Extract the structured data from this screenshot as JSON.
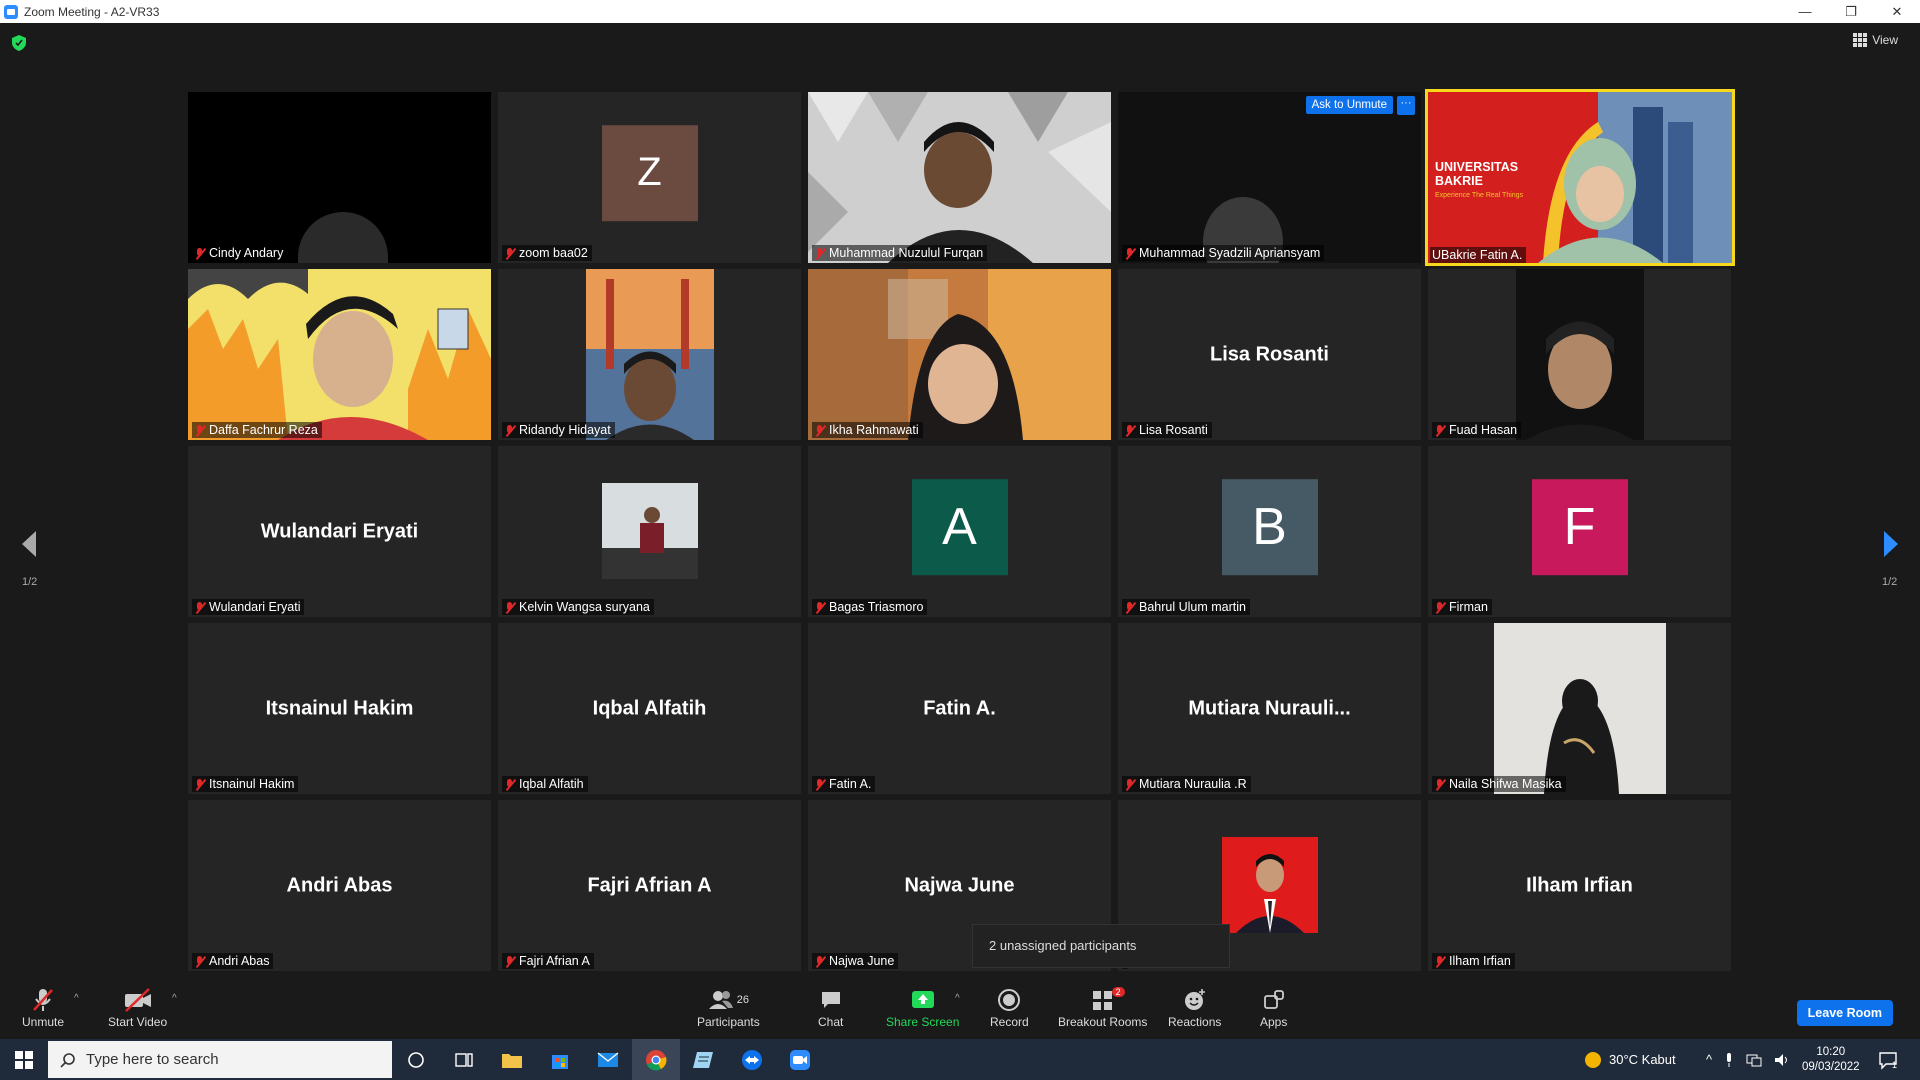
{
  "window": {
    "title": "Zoom Meeting - A2-VR33"
  },
  "header": {
    "view_label": "View"
  },
  "tiles": [
    {
      "name": "Cindy Andary",
      "display": ""
    },
    {
      "name": "zoom baa02",
      "avatar_letter": "Z",
      "avatar_color": "#6b4a3f"
    },
    {
      "name": "Muhammad Nuzulul Furqan"
    },
    {
      "name": "Muhammad Syadzili Apriansyam",
      "ask_label": "Ask to Unmute",
      "more_label": "···"
    },
    {
      "name": "UBakrie Fatin A.",
      "slide_title": "UNIVERSITAS BAKRIE",
      "slide_tagline": "Experience The Real Things"
    },
    {
      "name": "Daffa Fachrur Reza"
    },
    {
      "name": "Ridandy Hidayat"
    },
    {
      "name": "Ikha Rahmawati"
    },
    {
      "name": "Lisa Rosanti",
      "display": "Lisa Rosanti"
    },
    {
      "name": "Fuad Hasan"
    },
    {
      "name": "Wulandari Eryati",
      "display": "Wulandari Eryati"
    },
    {
      "name": "Kelvin Wangsa suryana"
    },
    {
      "name": "Bagas Triasmoro",
      "avatar_letter": "A",
      "avatar_color": "#0b5a4a"
    },
    {
      "name": "Bahrul Ulum martin",
      "avatar_letter": "B",
      "avatar_color": "#455a64"
    },
    {
      "name": "Firman",
      "avatar_letter": "F",
      "avatar_color": "#c8195c"
    },
    {
      "name": "Itsnainul Hakim",
      "display": "Itsnainul Hakim"
    },
    {
      "name": "Iqbal Alfatih",
      "display": "Iqbal Alfatih"
    },
    {
      "name": "Fatin A.",
      "display": "Fatin A."
    },
    {
      "name": "Mutiara Nuraulia .R",
      "display": "Mutiara  Nurauli..."
    },
    {
      "name": "Naila Shifwa Masika"
    },
    {
      "name": "Andri Abas",
      "display": "Andri Abas"
    },
    {
      "name": "Fajri Afrian A",
      "display": "Fajri Afrian A"
    },
    {
      "name": "Najwa June",
      "display": "Najwa June"
    },
    {
      "name": ""
    },
    {
      "name": "Ilham Irfian",
      "display": "Ilham Irfian"
    }
  ],
  "pagination": {
    "left": "1/2",
    "right": "1/2"
  },
  "tooltip": "2 unassigned participants",
  "toolbar": {
    "unmute": "Unmute",
    "start_video": "Start Video",
    "participants": "Participants",
    "participants_count": "26",
    "chat": "Chat",
    "share_screen": "Share Screen",
    "record": "Record",
    "breakout_rooms": "Breakout Rooms",
    "breakout_badge": "2",
    "reactions": "Reactions",
    "apps": "Apps",
    "leave": "Leave Room"
  },
  "taskbar": {
    "search_placeholder": "Type here to search",
    "weather": "30°C  Kabut",
    "time": "10:20",
    "date": "09/03/2022",
    "notif_count": "1"
  },
  "colors": {
    "accent": "#0e72ed",
    "active_speaker": "#f7d81a",
    "share_green": "#23d959",
    "mute_red": "#e02828"
  }
}
